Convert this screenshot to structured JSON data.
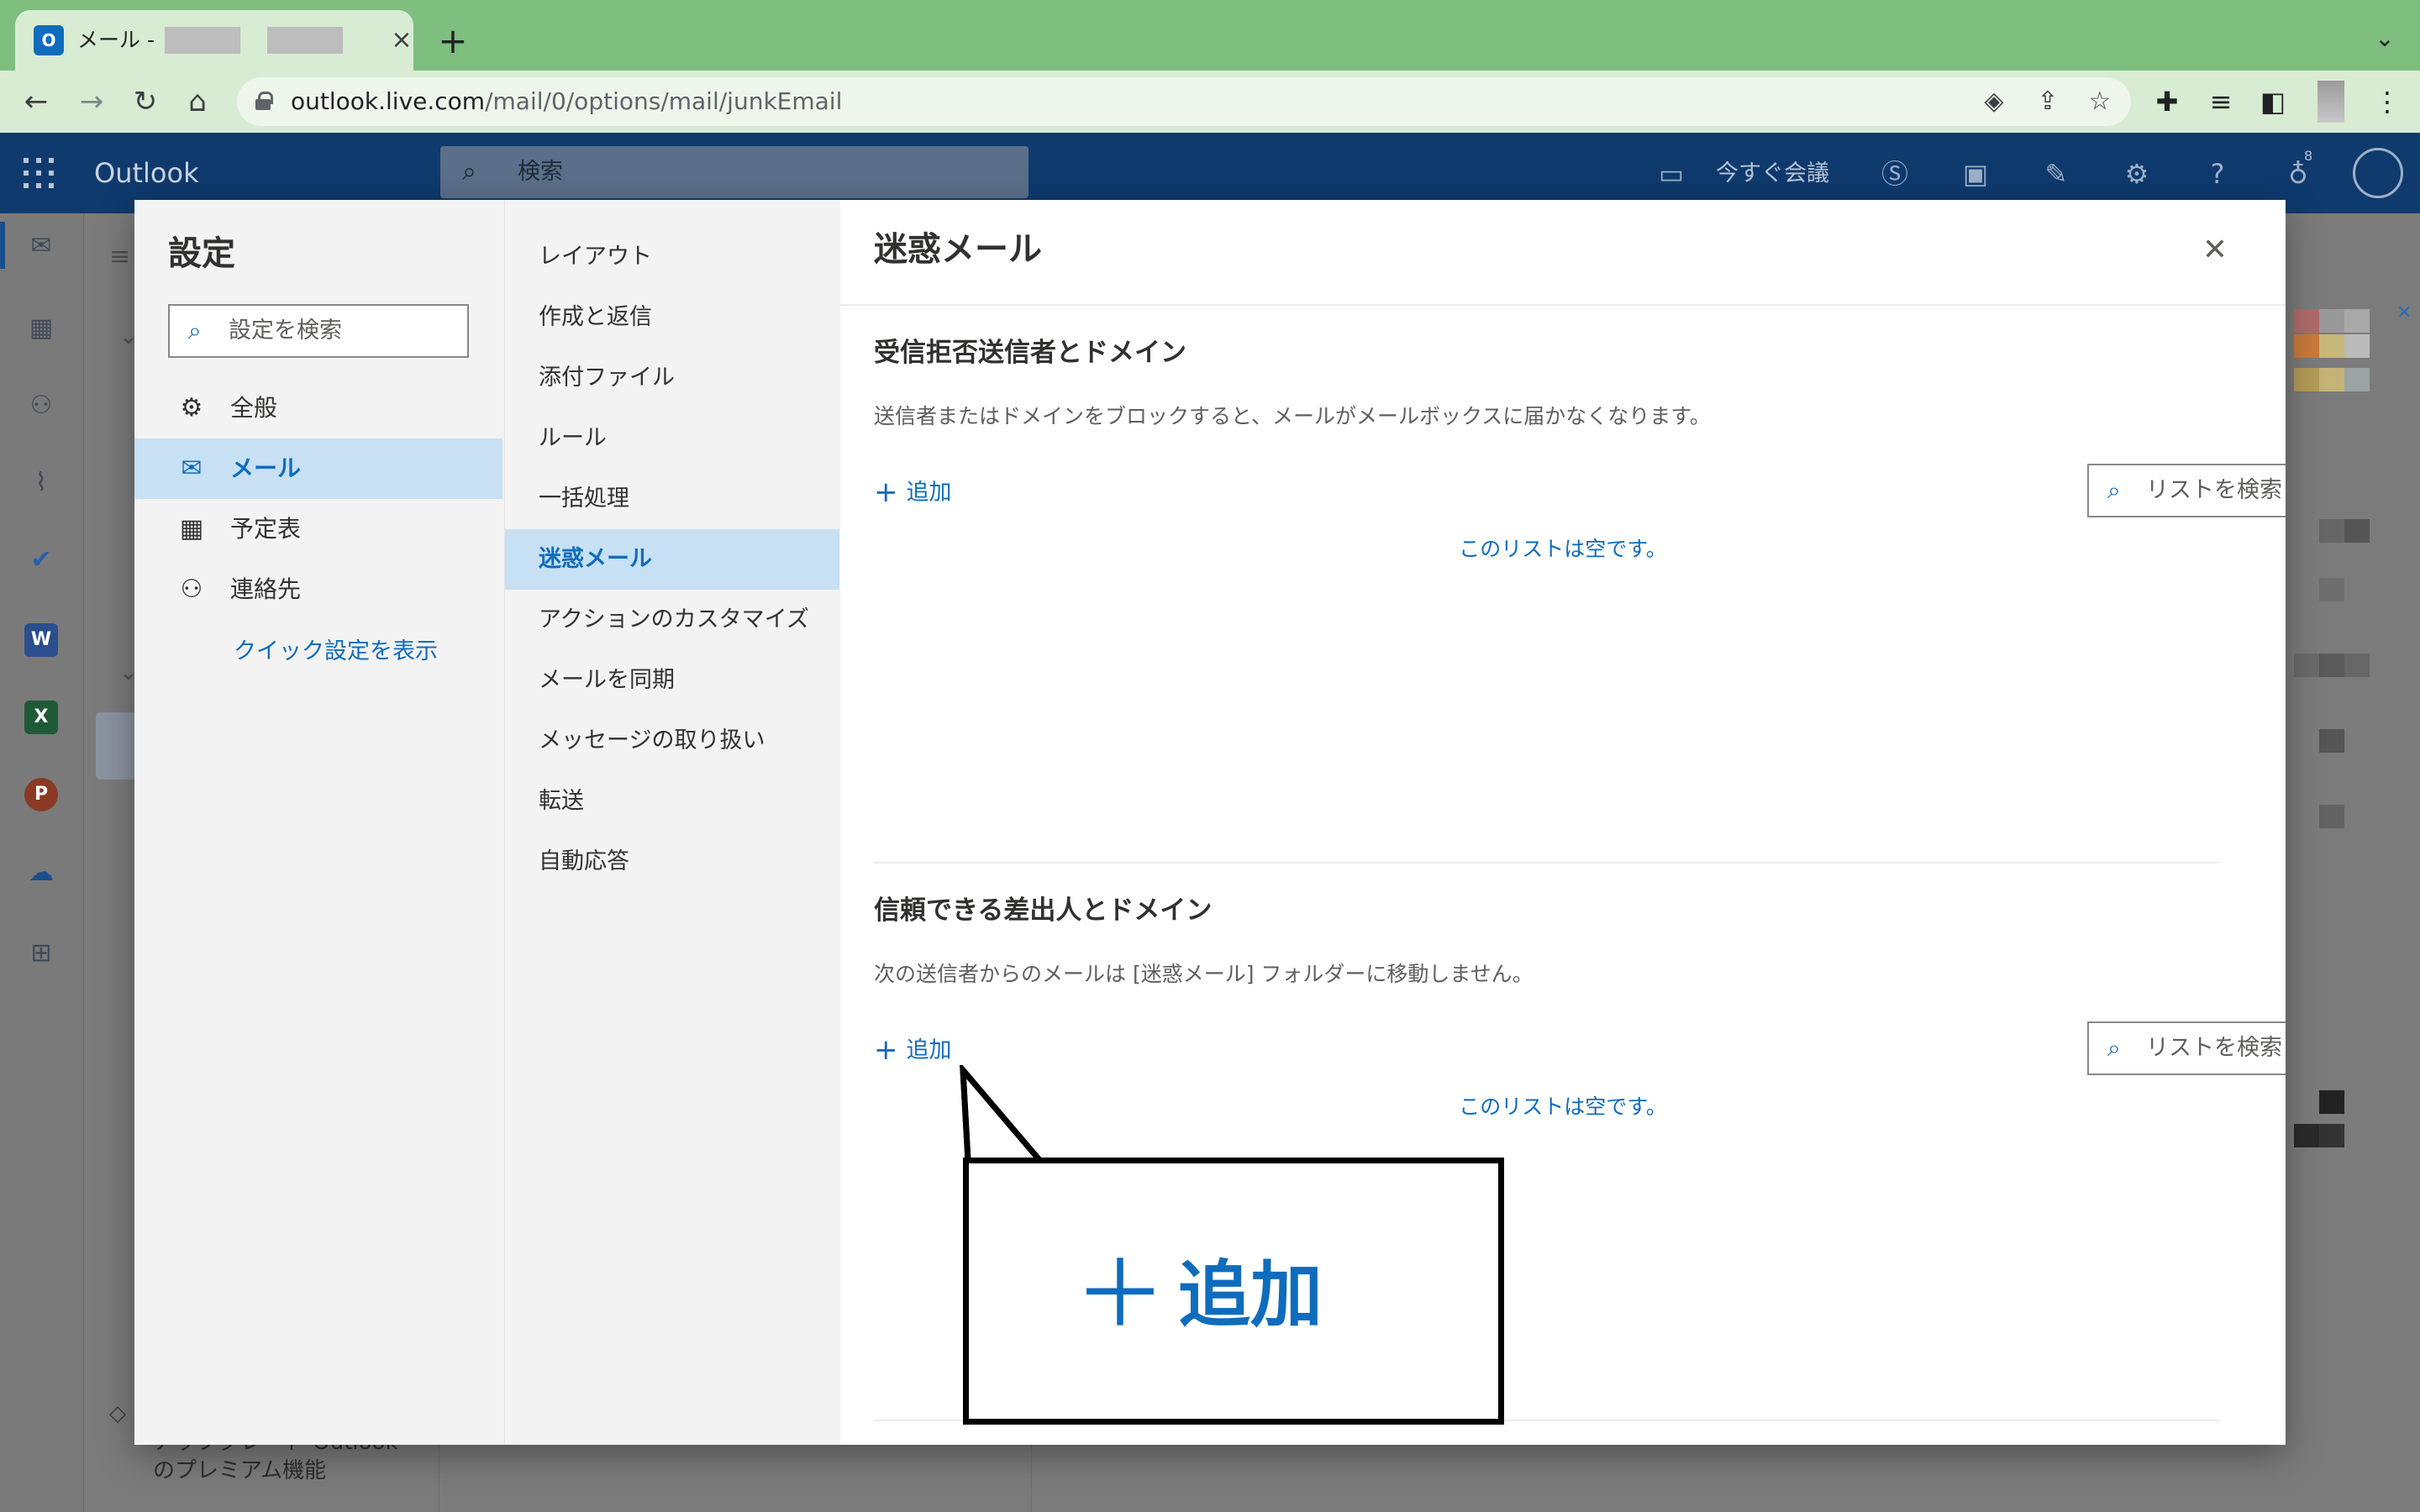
{
  "browser": {
    "tab_title": "メール - ",
    "tab_close": "×",
    "new_tab": "+",
    "tab_list": "⌄",
    "url_host": "outlook.live.com",
    "url_path": "/mail/0/options/mail/junkEmail"
  },
  "outlook": {
    "brand": "Outlook",
    "search_placeholder": "検索",
    "meet_now": "今すぐ会議",
    "notification_count": "8",
    "premium_line1": "アップグレード Outlook",
    "premium_line2": "のプレミアム機能"
  },
  "settings": {
    "title": "設定",
    "search_placeholder": "設定を検索",
    "categories": [
      {
        "label": "全般",
        "icon": "gear-icon"
      },
      {
        "label": "メール",
        "icon": "mail-icon"
      },
      {
        "label": "予定表",
        "icon": "calendar-icon"
      },
      {
        "label": "連絡先",
        "icon": "people-icon"
      }
    ],
    "active_category": "メール",
    "quick_settings_link": "クイック設定を表示",
    "mail_subsections": [
      "レイアウト",
      "作成と返信",
      "添付ファイル",
      "ルール",
      "一括処理",
      "迷惑メール",
      "アクションのカスタマイズ",
      "メールを同期",
      "メッセージの取り扱い",
      "転送",
      "自動応答"
    ],
    "active_subsection": "迷惑メール"
  },
  "junk_pane": {
    "title": "迷惑メール",
    "blocked": {
      "title": "受信拒否送信者とドメイン",
      "description": "送信者またはドメインをブロックすると、メールがメールボックスに届かなくなります。",
      "add_label": "追加",
      "search_placeholder": "リストを検索",
      "empty_message": "このリストは空です。"
    },
    "safe": {
      "title": "信頼できる差出人とドメイン",
      "description": "次の送信者からのメールは [迷惑メール] フォルダーに移動しません。",
      "add_label": "追加",
      "search_placeholder": "リストを検索",
      "empty_message": "このリストは空です。"
    }
  },
  "callout": {
    "text": "追加",
    "plus": "＋"
  },
  "colors": {
    "accent": "#0f6cbd",
    "selected_bg": "#c7e0f4",
    "outlook_header": "#0f3a6e",
    "browser_frame": "#7ebe7e"
  }
}
